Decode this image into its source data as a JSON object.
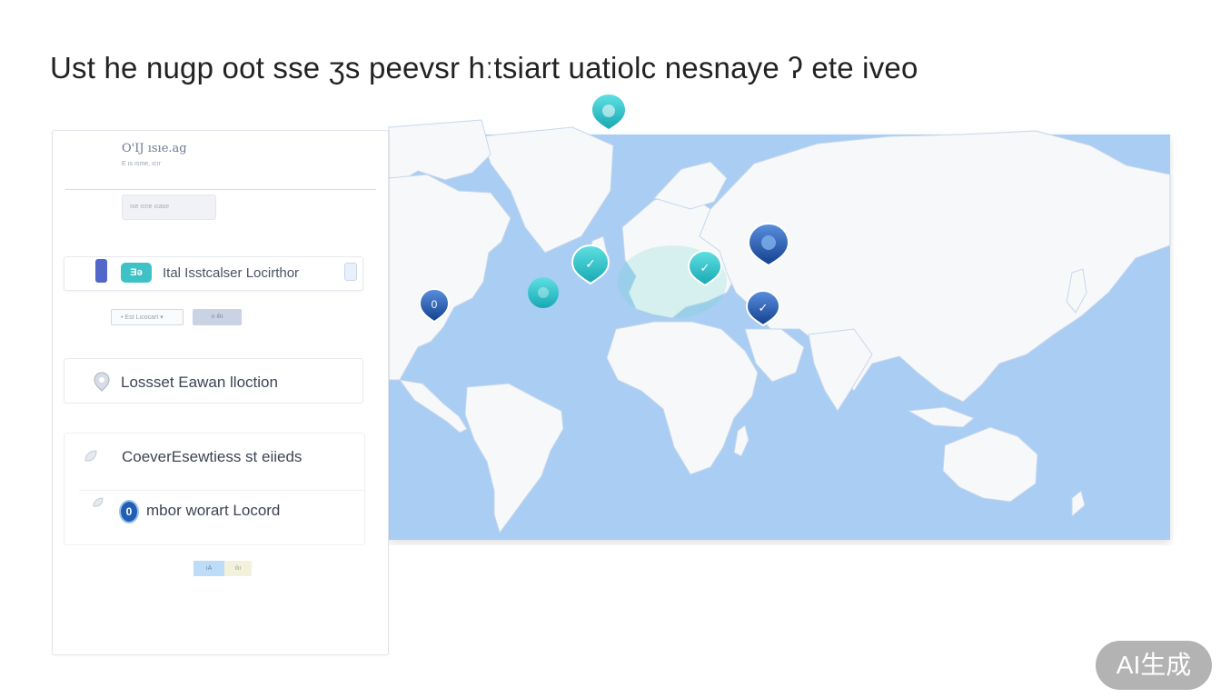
{
  "headline": "Ust he nugp oot sse ʒs peevsr hːtsiart uatiolc nesnaye ʔ ete iveo",
  "map": {
    "ocean_color": "#a9cdf3",
    "land_color": "#f7f8fa",
    "pin_colors": {
      "teal": "#2dbcc3",
      "blue": "#1c5eb6"
    },
    "pins": [
      {
        "name": "north-america-pin",
        "color": "blue",
        "glyph": "0"
      },
      {
        "name": "atlantic-pin",
        "color": "teal",
        "glyph": ""
      },
      {
        "name": "greenland-pin",
        "color": "teal",
        "glyph": "◎"
      },
      {
        "name": "uk-pin",
        "color": "teal",
        "glyph": "✓"
      },
      {
        "name": "central-europe-pin",
        "color": "teal",
        "glyph": "✓"
      },
      {
        "name": "russia-pin",
        "color": "blue",
        "glyph": "●"
      },
      {
        "name": "caucasus-pin",
        "color": "blue",
        "glyph": "✓"
      }
    ]
  },
  "panel": {
    "title": "O'IJ ısıe.ag",
    "subtitle": "E ıs ısme, ıcır",
    "chip": "ıse ıcne ıcase",
    "find": {
      "icon_text": "Ǝǝ",
      "label": "Ital Isstcalser Locirthor"
    },
    "mini_input": "• Est Lıcocart ▾",
    "mini_button": "ıı ılıı",
    "lost": {
      "label": "Lossset Eawan lloction"
    },
    "cover": {
      "label": "CoeverEsewtiess st eiieds",
      "badge": "0",
      "sub_label": "mbor worart Locord"
    },
    "legend": {
      "a": "ıA",
      "b": "ılıı"
    }
  },
  "watermark": "AI生成"
}
